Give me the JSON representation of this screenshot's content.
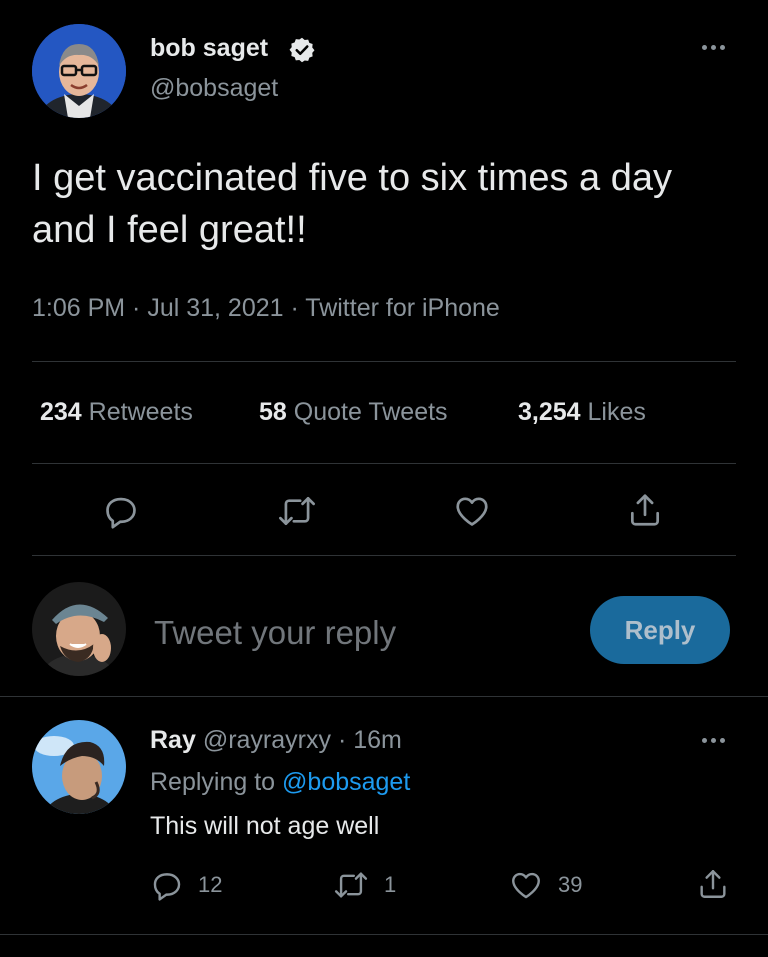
{
  "tweet": {
    "author_name": "bob saget",
    "author_handle": "@bobsaget",
    "text": "I get vaccinated five to six times a day and I feel great!!",
    "meta": "1:06 PM · Jul 31, 2021 · Twitter for iPhone",
    "stats": {
      "retweets_count": "234",
      "retweets_label": "Retweets",
      "quotes_count": "58",
      "quotes_label": "Quote Tweets",
      "likes_count": "3,254",
      "likes_label": "Likes"
    }
  },
  "compose": {
    "placeholder": "Tweet your reply",
    "reply_button": "Reply"
  },
  "reply": {
    "author_name": "Ray",
    "author_handle": "@rayrayrxy",
    "time": "· 16m",
    "replying_prefix": "Replying to",
    "replying_handle": "@bobsaget",
    "text": "This will not age well",
    "reply_count": "12",
    "retweet_count": "1",
    "like_count": "39"
  },
  "colors": {
    "background": "#000000",
    "text": "#e7e9ea",
    "muted": "#8b949b",
    "accent": "#1d9bf0",
    "reply_button": "#1a6a9c"
  },
  "icons": [
    "verified-badge-icon",
    "more-icon",
    "reply-icon",
    "retweet-icon",
    "like-icon",
    "share-icon"
  ]
}
